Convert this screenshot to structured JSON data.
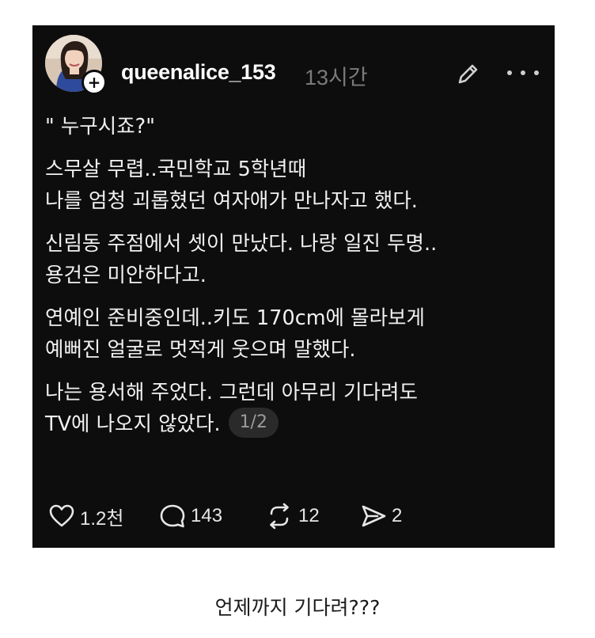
{
  "post": {
    "username": "queenalice_153",
    "timestamp": "13시간",
    "quote_line": "\" 누구시죠?\"",
    "paragraphs": [
      [
        "스무살 무렵..국민학교 5학년때",
        "나를 엄청 괴롭혔던 여자애가 만나자고 했다."
      ],
      [
        "신림동 주점에서 셋이 만났다. 나랑 일진 두명..",
        "용건은 미안하다고."
      ],
      [
        "연예인 준비중인데..키도 170cm에 몰라보게",
        "예뻐진 얼굴로 멋적게 웃으며 말했다."
      ],
      [
        "나는 용서해 주었다. 그런데 아무리 기다려도",
        "TV에 나오지 않았다."
      ]
    ],
    "page_indicator": "1/2",
    "icons": {
      "avatar": "profile-photo",
      "follow": "plus-icon",
      "edit": "pencil-icon",
      "more": "more-horizontal-icon"
    },
    "actions": {
      "likes": "1.2천",
      "comments": "143",
      "reposts": "12",
      "shares": "2"
    }
  },
  "caption": "언제까지 기다려???",
  "colors": {
    "card_background": "#0d0d0d",
    "text": "#f1f1f1",
    "muted": "#7b7b7b",
    "page_background": "#ffffff"
  }
}
